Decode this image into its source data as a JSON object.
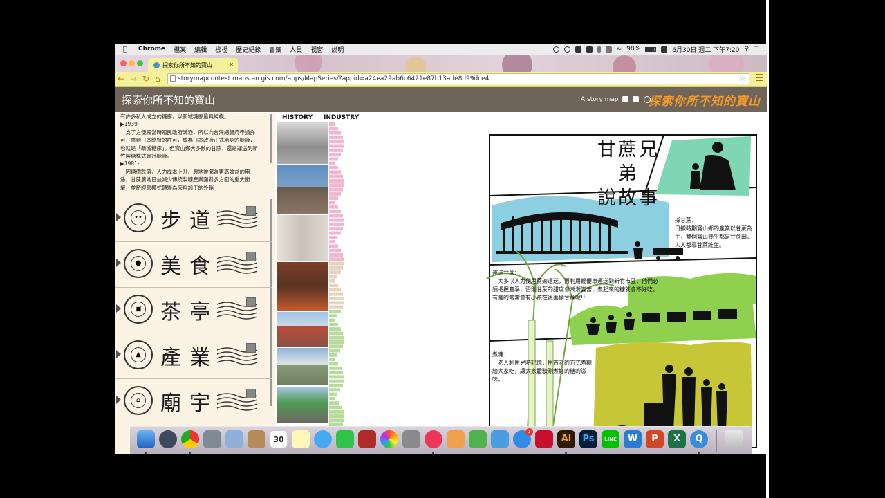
{
  "menubar": {
    "app": "Chrome",
    "items": [
      "檔案",
      "編輯",
      "檢視",
      "歷史紀錄",
      "書籤",
      "人員",
      "視窗",
      "說明"
    ],
    "battery": "98%",
    "datetime": "6月30日 週二 下午7:20"
  },
  "browser": {
    "tab_title": "探索你所不知的寶山",
    "url": "storymapcontest.maps.arcgis.com/apps/MapSeries/?appid=a24ea29ab6c6421e87b13ade8d99dce4"
  },
  "header": {
    "title": "探索你所不知的寶山",
    "story_link": "A story map",
    "logo_text": "探索你所不知的寶山"
  },
  "left_panel": {
    "text_lines": [
      "有許多私人成立的糖廍，以新城糖廍最具規模。",
      "▶1939-",
      "　為了方便殿當時殖民政府溝通，所以向台灣總督府申請許可，拿到日本總督的許可，成為日本政府正式承認的糖廠，也就是「新城糖廍」。但寶山鄉大多數的甘蔗，還是運送到新竹製糖株式會社糖廠。",
      "▶1981-",
      "　因糖價跌落，人力成本上升、農地被挪為更高效益的用途，甘蔗農地日益減少傳統製糖產業面對多方面的重大衝擊，並將經營模式轉變為來料加工的外銷"
    ],
    "categories": [
      {
        "name": "步道",
        "icon": "footprints-icon"
      },
      {
        "name": "美食",
        "icon": "food-icon"
      },
      {
        "name": "茶亭",
        "icon": "tea-pavilion-icon"
      },
      {
        "name": "產業",
        "icon": "industry-icon"
      },
      {
        "name": "廟宇",
        "icon": "temple-icon"
      }
    ]
  },
  "timeline": {
    "history_label": "HISTORY",
    "industry_label": "INDUSTRY"
  },
  "comic": {
    "title_line1": "甘蔗兄弟",
    "title_line2": "說故事",
    "caption1_title": "採甘蔗：",
    "caption1_body": "日據時期寶山鄉的產業以甘蔗為主，整個寶山幾乎都是甘蔗田，人人都靠甘蔗維生。",
    "caption2_title": "運送甘蔗：",
    "caption2_body": "　大多以人力使用蔗架運送，再利用輕便車運送到新竹市區，他們必須把握產季，否則甘蔗的甜度會漸漸變苦，煮起來的糖就會不好吃。有趣的常常會有小孩在後面偷甘蔗呢!!",
    "caption3_title": "煮糖：",
    "caption3_body": "　老人利用兒時記憶，用古老的方式煮糖給大家吃，讓大家體驗剛煮好的糖的滋味。"
  },
  "dock": {
    "calendar_day": "30",
    "appstore_badge": "1",
    "labels": [
      "Ai",
      "Ps",
      "LINE",
      "W",
      "P",
      "X",
      "Q"
    ]
  },
  "colors": {
    "chrome_yellow": "#f5f09a",
    "header_brown": "#6f6459",
    "panel_cream": "#fbf3e4",
    "comic_blue": "#8ccfe0",
    "comic_green": "#8fd14f",
    "comic_mint": "#7fd6b4",
    "comic_yellow": "#c6c636"
  }
}
